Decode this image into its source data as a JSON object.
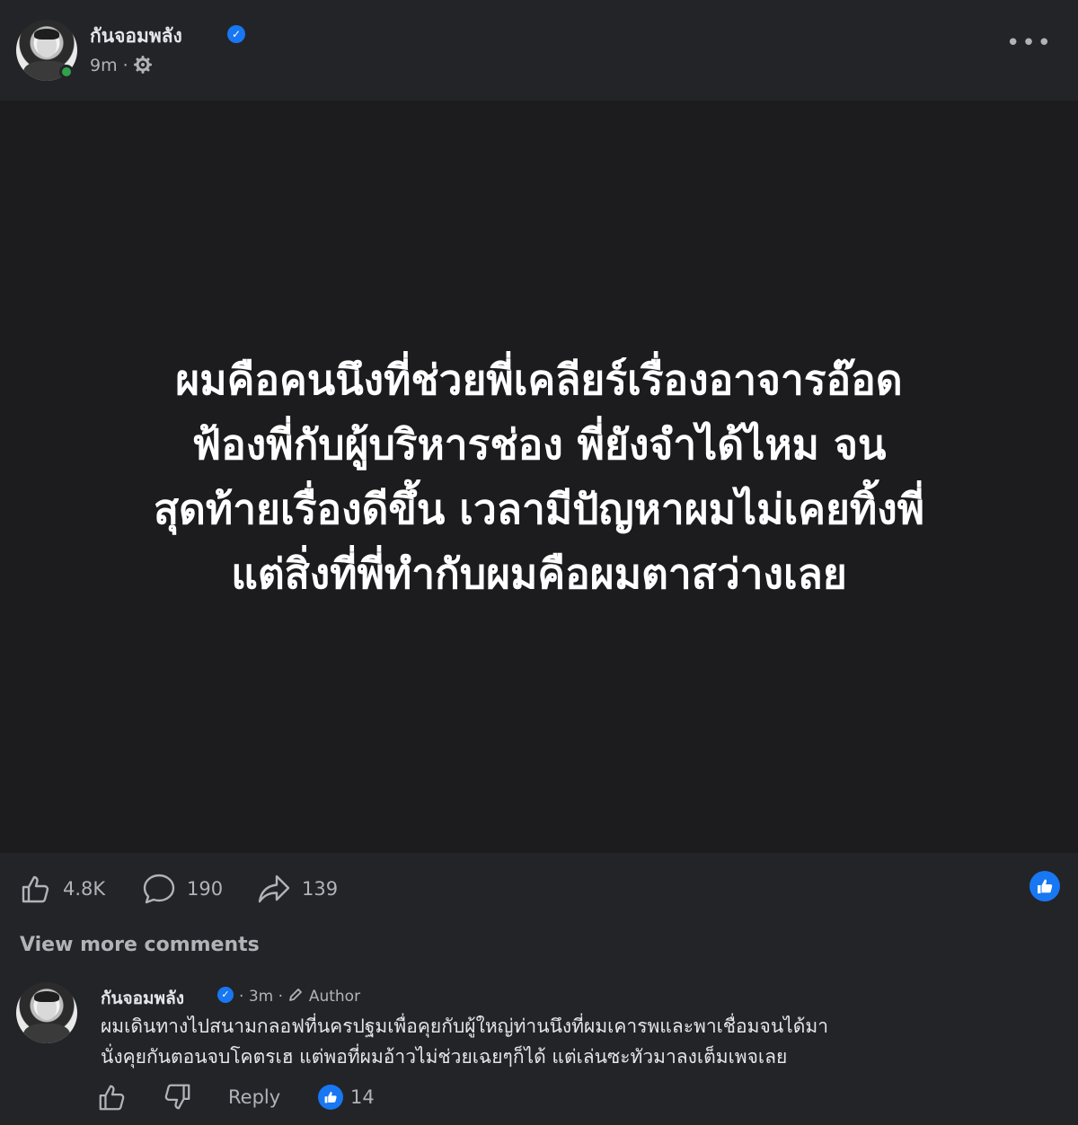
{
  "post": {
    "author": "กันจอมพลัง",
    "time": "9m",
    "time_separator": "·",
    "text": "ผมคือคนนึงที่ช่วยพี่เคลียร์เรื่องอาจารอ๊อดฟ้องพี่กับผู้บริหารช่อง พี่ยังจำได้ไหม จนสุดท้ายเรื่องดีขึ้น เวลามีปัญหาผมไม่เคยทิ้งพี่แต่สิ่งที่พี่ทำกับผมคือผมตาสว่างเลย",
    "text_lines": [
      "ผมคือคนนึงที่ช่วยพี่เคลียร์เรื่องอาจารอ๊อด",
      "ฟ้องพี่กับผู้บริหารช่อง พี่ยังจำได้ไหม จน",
      "สุดท้ายเรื่องดีขึ้น เวลามีปัญหาผมไม่เคยทิ้งพี่",
      "แต่สิ่งที่พี่ทำกับผมคือผมตาสว่างเลย"
    ],
    "more_icon": "more-options-icon",
    "privacy_icon": "gear-icon"
  },
  "stats": {
    "likes": "4.8K",
    "comments": "190",
    "shares": "139"
  },
  "view_more_comments": "View more comments",
  "comment": {
    "author": "กันจอมพลัง",
    "time": "3m",
    "author_badge": "Author",
    "line1": "ผมเดินทางไปสนามกลอฟที่นครปฐมเพื่อคุยกับผู้ใหญ่ท่านนึงที่ผมเคารพและพาเชื่อมจนได้มา",
    "line2": "นั่งคุยกันตอนจบโคตรเฮ แต่พอที่ผมอ้าวไม่ช่วยเฉยๆก็ได้ แต่เล่นซะทัวมาลงเต็มเพจเลย",
    "reply_label": "Reply",
    "reaction_count": "14"
  },
  "colors": {
    "background": "#232427",
    "image_bg": "#1c1c1e",
    "accent": "#1877f2",
    "online": "#31a24c",
    "muted_text": "#b0b3b8"
  }
}
